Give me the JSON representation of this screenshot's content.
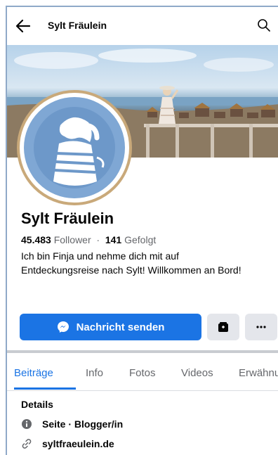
{
  "header": {
    "title": "Sylt Fräulein"
  },
  "profile": {
    "name": "Sylt Fräulein",
    "followers_count": "45.483",
    "followers_label": "Follower",
    "separator": "·",
    "following_count": "141",
    "following_label": "Gefolgt",
    "bio": "Ich bin Finja und nehme dich mit auf Entdeckungsreise nach Sylt! Willkommen an Bord!"
  },
  "actions": {
    "message_label": "Nachricht senden",
    "colors": {
      "primary": "#1b74e4",
      "secondary_bg": "#e4e6eb"
    }
  },
  "tabs": [
    {
      "label": "Beiträge",
      "active": true
    },
    {
      "label": "Info"
    },
    {
      "label": "Fotos"
    },
    {
      "label": "Videos"
    },
    {
      "label": "Erwähnu"
    }
  ],
  "details": {
    "title": "Details",
    "items": [
      {
        "icon": "info-icon",
        "text": "Seite · Blogger/in"
      },
      {
        "icon": "link-icon",
        "text": "syltfraeulein.de"
      }
    ]
  }
}
